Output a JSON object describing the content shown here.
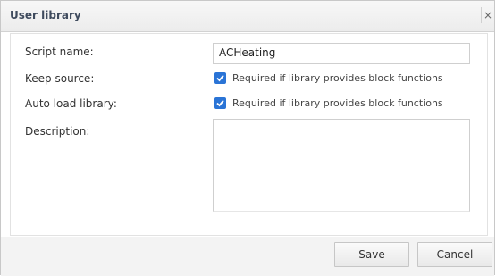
{
  "dialog": {
    "title": "User library",
    "close_glyph": "×"
  },
  "form": {
    "script_name_label": "Script name:",
    "script_name_value": "ACHeating",
    "keep_source_label": "Keep source:",
    "keep_source_checked": true,
    "keep_source_hint": "Required if library provides block functions",
    "auto_load_label": "Auto load library:",
    "auto_load_checked": true,
    "auto_load_hint": "Required if library provides block functions",
    "description_label": "Description:",
    "description_value": ""
  },
  "buttons": {
    "save_label": "Save",
    "cancel_label": "Cancel"
  },
  "colors": {
    "checkbox": "#2a74d6",
    "title_text": "#3f4b5e"
  }
}
